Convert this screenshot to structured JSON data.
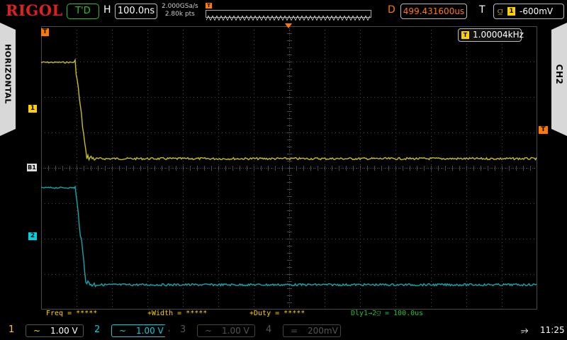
{
  "brand": "RIGOL",
  "run_state": "T'D",
  "horizontal": {
    "letter": "H",
    "timebase": "100.0ns",
    "sample_rate": "2.000GSa/s",
    "memory_depth": "2.80k pts"
  },
  "delay": {
    "letter": "D",
    "value": "499.431600us"
  },
  "trigger": {
    "letter": "T",
    "source": "1",
    "level": "-600mV",
    "edge_icon": "falling-edge-icon"
  },
  "side_tabs": {
    "left": "HORIZONTAL",
    "right": "CH2"
  },
  "markers": {
    "trigger_top": "T",
    "ch1": "1",
    "bus": "B1",
    "ch2": "2",
    "trigger_level": "T"
  },
  "frequency_counter": {
    "badge": "T",
    "value": "1.00004kHz"
  },
  "measurements": [
    {
      "text": "Freq = *****",
      "color": "#ffd000"
    },
    {
      "text": "+Width = *****",
      "color": "#ffd000"
    },
    {
      "text": "+Duty = *****",
      "color": "#ffd000"
    },
    {
      "text": "Dly1→2⫑ = 100.0us",
      "color": "#23c13a"
    }
  ],
  "channels": [
    {
      "num": "1",
      "coupling": "~",
      "scale": "1.00 V",
      "color": "#ffd000",
      "active": false,
      "enabled": true
    },
    {
      "num": "2",
      "coupling": "~",
      "scale": "1.00 V",
      "color": "#00d0e0",
      "active": true,
      "enabled": true
    },
    {
      "num": "3",
      "coupling": "~",
      "scale": "1.00 V",
      "color": "#555555",
      "active": false,
      "enabled": false
    },
    {
      "num": "4",
      "coupling": "=",
      "scale": "200mV",
      "color": "#555555",
      "active": false,
      "enabled": false
    }
  ],
  "status": {
    "usb_icon": "usb-icon",
    "time": "11:25"
  },
  "colors": {
    "ch1": "#ffd000",
    "ch2": "#00d0e0",
    "trigger": "#ff7a00",
    "grid": "#4a4a4a"
  }
}
